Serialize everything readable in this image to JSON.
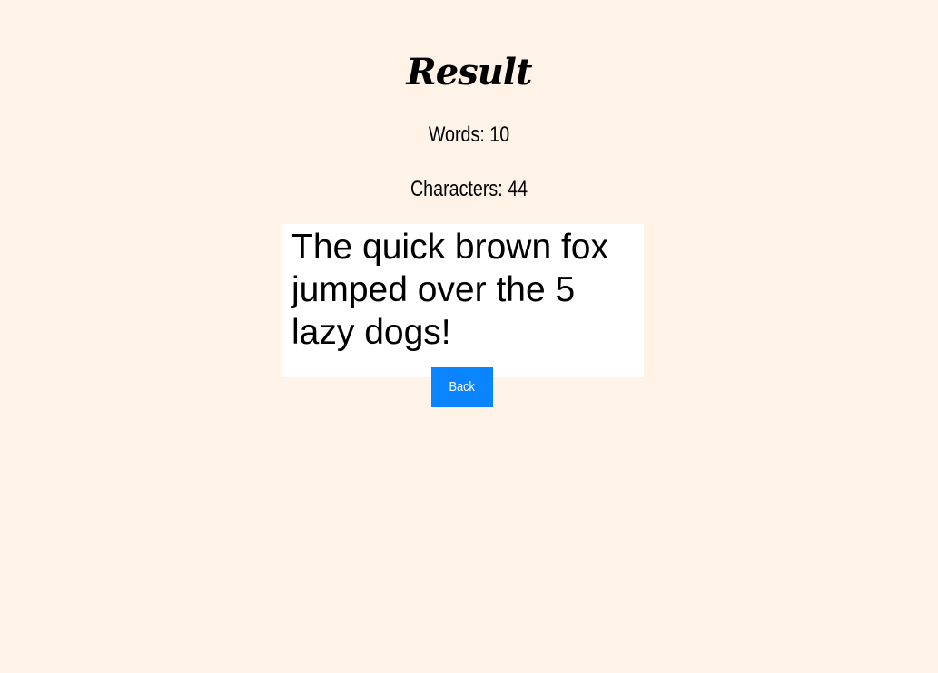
{
  "page": {
    "title": "Result",
    "words_label": "Words: 10",
    "characters_label": "Characters: 44",
    "image_text": "The quick brown fox\njumped over the 5\nlazy dogs!",
    "back_label": "Back"
  },
  "colors": {
    "background": "#fff2e6",
    "button": "#0a84ff",
    "button_text": "#ffffff"
  }
}
